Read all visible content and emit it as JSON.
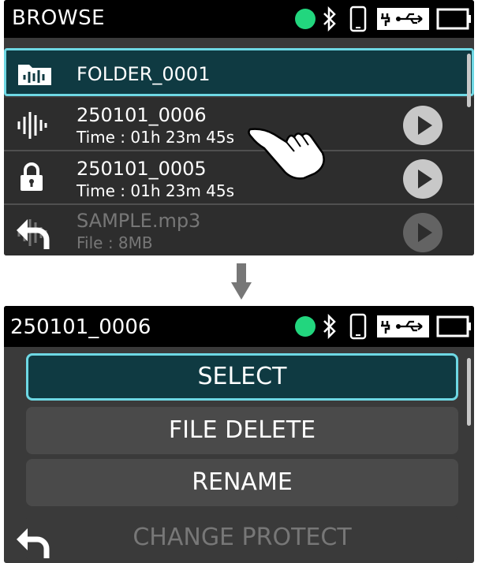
{
  "browse": {
    "title": "BROWSE",
    "items": [
      {
        "title": "FOLDER_0001",
        "subtitle": "",
        "icon": "folder-waveform-icon",
        "selected": true
      },
      {
        "title": "250101_0006",
        "subtitle": "Time : 01h 23m 45s",
        "icon": "waveform-icon"
      },
      {
        "title": "250101_0005",
        "subtitle": "Time : 01h 23m 45s",
        "icon": "lock-icon"
      },
      {
        "title": "SAMPLE.mp3",
        "subtitle": "File : 8MB",
        "icon": "waveform-icon",
        "dimmed": true
      }
    ]
  },
  "file_menu": {
    "title": "250101_0006",
    "options": [
      {
        "label": "SELECT",
        "selected": true
      },
      {
        "label": "FILE DELETE"
      },
      {
        "label": "RENAME"
      },
      {
        "label": "CHANGE PROTECT",
        "dimmed": true
      }
    ]
  },
  "status_icons": [
    "status-dot-icon",
    "bluetooth-icon",
    "phone-icon",
    "usb-power-icon",
    "battery-icon"
  ],
  "colors": {
    "status_dot": "#22d67e",
    "selection_border": "#6ed8e4",
    "selection_fill": "#0f3a42"
  }
}
